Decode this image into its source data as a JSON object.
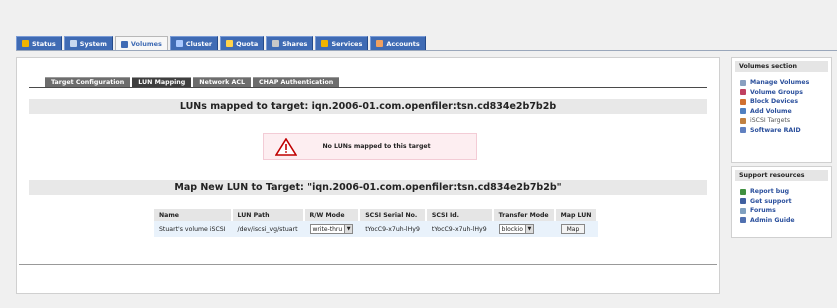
{
  "topnav": {
    "tabs": [
      {
        "label": "Status",
        "icon": "status-icon",
        "color": "#f0b400"
      },
      {
        "label": "System",
        "icon": "system-icon",
        "color": "#c8d8f0"
      },
      {
        "label": "Volumes",
        "icon": "volumes-icon",
        "color": "#3f6bb4"
      },
      {
        "label": "Cluster",
        "icon": "cluster-icon",
        "color": "#a8c8ff"
      },
      {
        "label": "Quota",
        "icon": "quota-icon",
        "color": "#ffd24a"
      },
      {
        "label": "Shares",
        "icon": "shares-icon",
        "color": "#c8c8c8"
      },
      {
        "label": "Services",
        "icon": "services-icon",
        "color": "#f0b400"
      },
      {
        "label": "Accounts",
        "icon": "accounts-icon",
        "color": "#f0a060"
      }
    ],
    "active": "Volumes"
  },
  "subtabs": [
    {
      "label": "Target Configuration"
    },
    {
      "label": "LUN Mapping"
    },
    {
      "label": "Network ACL"
    },
    {
      "label": "CHAP Authentication"
    }
  ],
  "mapped_heading": "LUNs mapped to target: iqn.2006-01.com.openfiler:tsn.cd834e2b7b2b",
  "warning": {
    "message": "No LUNs mapped to this target",
    "icon": "warning-icon"
  },
  "map_heading": "Map New LUN to Target: \"iqn.2006-01.com.openfiler:tsn.cd834e2b7b2b\"",
  "lun_table": {
    "headers": [
      "Name",
      "LUN Path",
      "R/W Mode",
      "SCSI Serial No.",
      "SCSI Id.",
      "Transfer Mode",
      "Map LUN"
    ],
    "row": {
      "name": "Stuart's volume iSCSI",
      "lun_path": "/dev/iscsi_vg/stuart",
      "rw_mode": "write-thru",
      "serial": "tYocC9-x7uh-lHy9",
      "scsi_id": "tYocC9-x7uh-lHy9",
      "transfer_mode": "blockio",
      "map_button": "Map"
    }
  },
  "volumes_section": {
    "title": "Volumes section",
    "items": [
      {
        "label": "Manage Volumes",
        "icon": "manage-volumes-icon",
        "color": "#8aa0c0"
      },
      {
        "label": "Volume Groups",
        "icon": "volume-groups-icon",
        "color": "#c04060"
      },
      {
        "label": "Block Devices",
        "icon": "block-devices-icon",
        "color": "#d07030"
      },
      {
        "label": "Add Volume",
        "icon": "add-volume-icon",
        "color": "#5080c0"
      },
      {
        "label": "iSCSI Targets",
        "icon": "iscsi-targets-icon",
        "color": "#c08040"
      },
      {
        "label": "Software RAID",
        "icon": "software-raid-icon",
        "color": "#6080c0"
      }
    ]
  },
  "support_resources": {
    "title": "Support resources",
    "items": [
      {
        "label": "Report bug",
        "icon": "report-bug-icon",
        "color": "#409040"
      },
      {
        "label": "Get support",
        "icon": "get-support-icon",
        "color": "#4060a0"
      },
      {
        "label": "Forums",
        "icon": "forums-icon",
        "color": "#80a0c0"
      },
      {
        "label": "Admin Guide",
        "icon": "admin-guide-icon",
        "color": "#5070b0"
      }
    ]
  }
}
